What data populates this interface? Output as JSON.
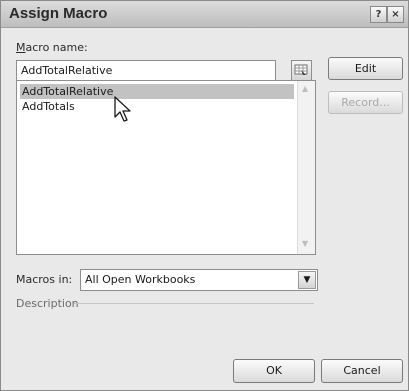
{
  "window": {
    "title": "Assign Macro",
    "help_glyph": "?",
    "close_glyph": "×"
  },
  "macro_name": {
    "label_prefix": "M",
    "label_rest": "acro name:",
    "value": "AddTotalRelative"
  },
  "macro_list": {
    "items": [
      {
        "label": "AddTotalRelative",
        "selected": true
      },
      {
        "label": "AddTotals",
        "selected": false
      }
    ]
  },
  "buttons": {
    "edit": "Edit",
    "record": "Record...",
    "ok": "OK",
    "cancel": "Cancel"
  },
  "macros_in": {
    "label": "Macros in:",
    "value": "All Open Workbooks"
  },
  "description": {
    "label": "Description"
  },
  "icons": {
    "collapse_dialog": "range-picker-icon",
    "dropdown": "chevron-down-icon",
    "cursor": "mouse-pointer-icon"
  }
}
